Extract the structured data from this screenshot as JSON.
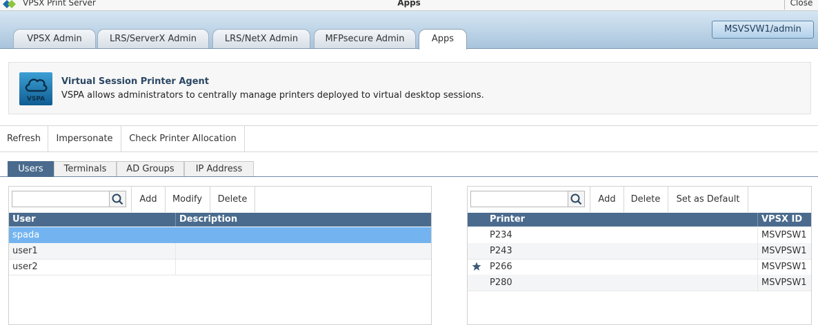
{
  "titlebar": {
    "app_name": "VPSX Print Server",
    "window_title": "Apps",
    "close_label": "Close"
  },
  "header": {
    "tabs": [
      {
        "label": "VPSX Admin"
      },
      {
        "label": "LRS/ServerX Admin"
      },
      {
        "label": "LRS/NetX Admin"
      },
      {
        "label": "MFPsecure Admin"
      },
      {
        "label": "Apps"
      }
    ],
    "active_tab": "Apps",
    "user_button": "MSVSVW1/admin"
  },
  "banner": {
    "logo_text": "VSPA",
    "title": "Virtual Session Printer Agent",
    "description": "VSPA allows administrators to centrally manage printers deployed to virtual desktop sessions."
  },
  "toolbar": {
    "refresh": "Refresh",
    "impersonate": "Impersonate",
    "check_allocation": "Check Printer Allocation"
  },
  "subtabs": {
    "items": [
      {
        "label": "Users"
      },
      {
        "label": "Terminals"
      },
      {
        "label": "AD Groups"
      },
      {
        "label": "IP Address"
      }
    ],
    "active": "Users"
  },
  "users_panel": {
    "search_placeholder": "",
    "add": "Add",
    "modify": "Modify",
    "delete": "Delete",
    "columns": [
      "User",
      "Description"
    ],
    "rows": [
      {
        "user": "spada",
        "description": "",
        "selected": true
      },
      {
        "user": "user1",
        "description": ""
      },
      {
        "user": "user2",
        "description": ""
      }
    ]
  },
  "printers_panel": {
    "search_placeholder": "",
    "add": "Add",
    "delete": "Delete",
    "set_default": "Set as Default",
    "columns": [
      "Printer",
      "VPSX ID"
    ],
    "rows": [
      {
        "printer": "P234",
        "vpsx_id": "MSVPSW1",
        "default": false
      },
      {
        "printer": "P243",
        "vpsx_id": "MSVPSW1",
        "default": false
      },
      {
        "printer": "P266",
        "vpsx_id": "MSVPSW1",
        "default": true
      },
      {
        "printer": "P280",
        "vpsx_id": "MSVPSW1",
        "default": false
      }
    ]
  },
  "colors": {
    "grid_header": "#4a6b8d",
    "selected_row": "#73b4f0",
    "header_band": "#a8c4dc"
  }
}
